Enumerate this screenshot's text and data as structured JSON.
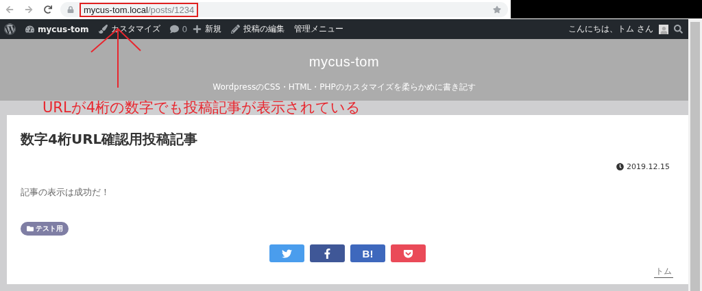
{
  "browser": {
    "url_host": "mycus-tom.local",
    "url_path": "/posts/1234"
  },
  "admin_bar": {
    "items": [
      {
        "kind": "logo"
      },
      {
        "kind": "site",
        "label": "mycus-tom"
      },
      {
        "kind": "customize",
        "label": "カスタマイズ"
      },
      {
        "kind": "comments",
        "label": "0"
      },
      {
        "kind": "new",
        "label": "新規"
      },
      {
        "kind": "edit",
        "label": "投稿の編集"
      },
      {
        "kind": "menu",
        "label": "管理メニュー"
      }
    ],
    "greeting": "こんにちは、トム さん"
  },
  "header": {
    "title": "mycus-tom",
    "tagline": "WordpressのCSS・HTML・PHPのカスタマイズを柔らかめに書き記す"
  },
  "annotation": {
    "text": "URLが4桁の数字でも投稿記事が表示されている"
  },
  "post": {
    "title": "数字4桁URL確認用投稿記事",
    "date": "2019.12.15",
    "body": "記事の表示は成功だ！",
    "category": "テスト用",
    "author": "トム"
  },
  "share_buttons": [
    {
      "kind": "twitter",
      "color": "#4a9ded"
    },
    {
      "kind": "facebook",
      "color": "#3f5797"
    },
    {
      "kind": "hatena",
      "label": "B!",
      "color": "#3e68bd"
    },
    {
      "kind": "pocket",
      "color": "#ea4a58"
    }
  ]
}
